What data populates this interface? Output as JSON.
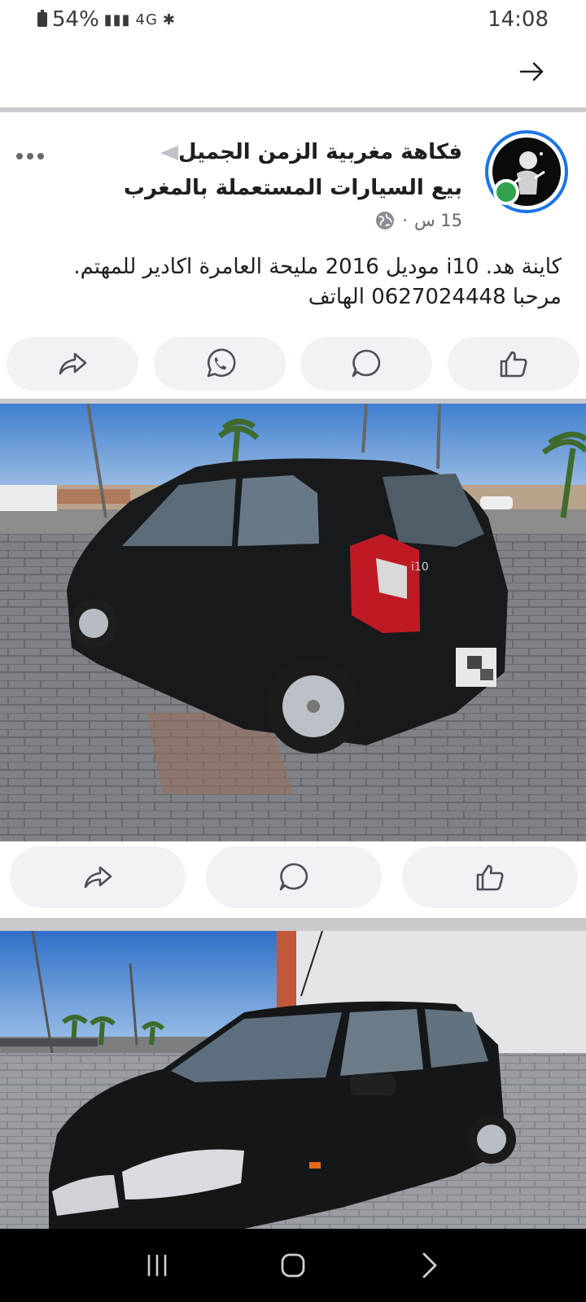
{
  "status_bar": {
    "battery_percent": "54%",
    "network": "4G",
    "time": "14:08"
  },
  "top_bar": {
    "back_icon": "arrow-right-icon"
  },
  "post": {
    "page_name": "فكاهة مغربية الزمن الجميل",
    "group_name": "بيع السيارات المستعملة بالمغرب",
    "time_ago": "15 س",
    "separator": "·",
    "privacy_icon": "globe-icon",
    "text_line_1": "كاينة هد. i10 موديل 2016 مليحة العامرة اكادير للمهتم.",
    "text_line_2": "مرحبا 0627024448 الهاتف"
  },
  "actions_top": [
    "share-icon",
    "whatsapp-icon",
    "comment-icon",
    "like-icon"
  ],
  "actions_photo": [
    "share-icon",
    "comment-icon",
    "like-icon"
  ],
  "photo_1": {
    "badge": "i10"
  },
  "colors": {
    "accent": "#1b74e4",
    "online": "#31a24c",
    "pill_bg": "#f0f2f5",
    "divider": "#c8cacd"
  },
  "nav_bar": {
    "items": [
      "recent-apps-icon",
      "home-icon",
      "back-icon"
    ]
  }
}
